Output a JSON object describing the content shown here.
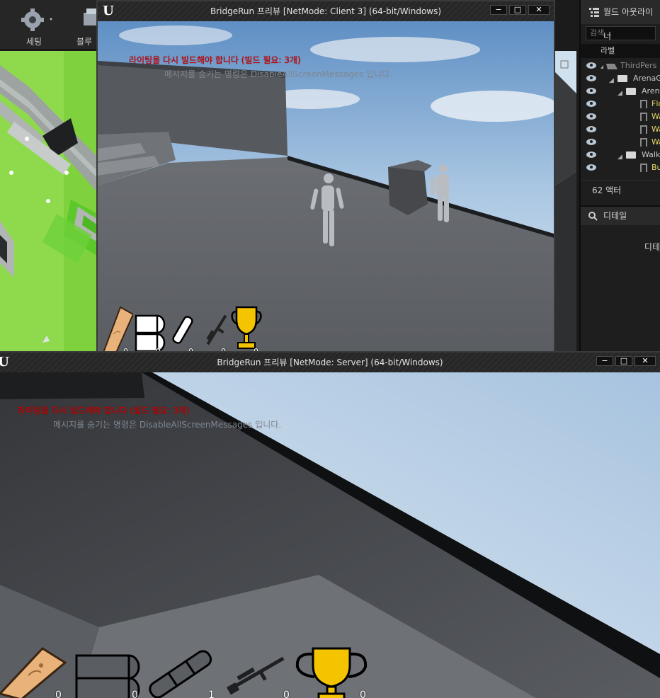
{
  "editor": {
    "toolbar": {
      "settings_label": "세팅",
      "blueprint_label": "블루프"
    },
    "outliner": {
      "title": "월드 아웃라이너",
      "search_placeholder": "검색...",
      "column_label": "라벨",
      "items": [
        {
          "label": "ThirdPers",
          "type": "world"
        },
        {
          "label": "ArenaG",
          "type": "folder"
        },
        {
          "label": "Arena",
          "type": "folder"
        },
        {
          "label": "Flo",
          "type": "actor"
        },
        {
          "label": "Wa",
          "type": "actor"
        },
        {
          "label": "Wa",
          "type": "actor"
        },
        {
          "label": "Wa",
          "type": "actor"
        },
        {
          "label": "Walk",
          "type": "folder"
        },
        {
          "label": "Bu",
          "type": "actor"
        }
      ],
      "actor_count": "62 액터"
    },
    "details": {
      "title": "디테일",
      "body_text": "디테"
    }
  },
  "client_window": {
    "title": "BridgeRun 프리뷰 [NetMode: Client 3]  (64-bit/Windows)",
    "logo": "U",
    "buttons": {
      "minimize": "−",
      "maximize": "□",
      "close": "✕"
    },
    "messages": {
      "rebuild_warning": "라이팅을 다시 빌드해야 합니다 (빌드 필요: 3개)",
      "hide_hint": "메시지를 숨기는 명령은 DisableAllScreenMessages 입니다."
    },
    "hud_counts": [
      "0",
      "0",
      "0",
      "0",
      "0"
    ]
  },
  "server_window": {
    "title": "BridgeRun 프리뷰 [NetMode: Server]  (64-bit/Windows)",
    "buttons": {
      "minimize": "−",
      "maximize": "□",
      "close": "✕"
    },
    "messages": {
      "rebuild_warning": "라이팅을 다시 빌드해야 합니다 (빌드 필요: 3개)",
      "hide_hint": "메시지를 숨기는 명령은 DisableAllScreenMessages 입니다."
    },
    "hud_counts": [
      "0",
      "0",
      "1",
      "0",
      "0"
    ]
  },
  "hud_icons": [
    "wood-plank",
    "rope-coil",
    "telescope",
    "sniper-rifle",
    "trophy"
  ],
  "colors": {
    "trophy": "#f5c400",
    "wood": "#e8b27a",
    "warning_text": "#d10000",
    "grass": "#8fd94c"
  }
}
